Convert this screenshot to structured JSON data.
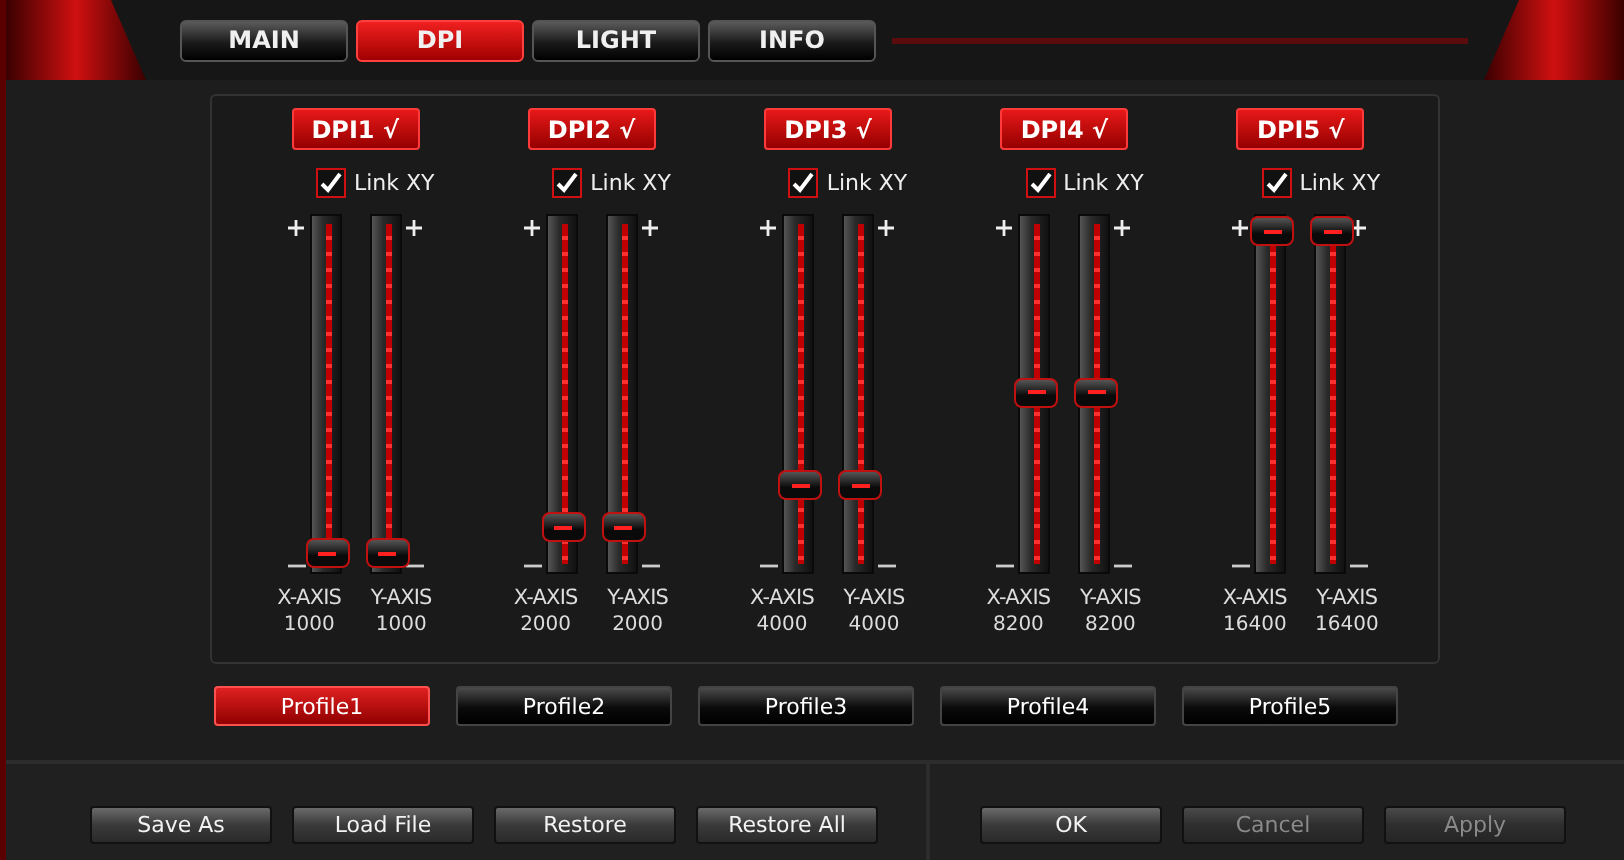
{
  "tabs": [
    {
      "label": "MAIN",
      "selected": false
    },
    {
      "label": "DPI",
      "selected": true
    },
    {
      "label": "LIGHT",
      "selected": false
    },
    {
      "label": "INFO",
      "selected": false
    }
  ],
  "dpi_stages": [
    {
      "label": "DPI1 √",
      "link_xy": {
        "label": "Link XY",
        "checked": true
      },
      "x_axis": {
        "label": "X-AXIS",
        "value": "1000",
        "level": 0
      },
      "y_axis": {
        "label": "Y-AXIS",
        "value": "1000",
        "level": 0
      }
    },
    {
      "label": "DPI2 √",
      "link_xy": {
        "label": "Link XY",
        "checked": true
      },
      "x_axis": {
        "label": "X-AXIS",
        "value": "2000",
        "level": 0.08
      },
      "y_axis": {
        "label": "Y-AXIS",
        "value": "2000",
        "level": 0.08
      }
    },
    {
      "label": "DPI3 √",
      "link_xy": {
        "label": "Link XY",
        "checked": true
      },
      "x_axis": {
        "label": "X-AXIS",
        "value": "4000",
        "level": 0.21
      },
      "y_axis": {
        "label": "Y-AXIS",
        "value": "4000",
        "level": 0.21
      }
    },
    {
      "label": "DPI4 √",
      "link_xy": {
        "label": "Link XY",
        "checked": true
      },
      "x_axis": {
        "label": "X-AXIS",
        "value": "8200",
        "level": 0.5
      },
      "y_axis": {
        "label": "Y-AXIS",
        "value": "8200",
        "level": 0.5
      }
    },
    {
      "label": "DPI5 √",
      "link_xy": {
        "label": "Link XY",
        "checked": true
      },
      "x_axis": {
        "label": "X-AXIS",
        "value": "16400",
        "level": 1
      },
      "y_axis": {
        "label": "Y-AXIS",
        "value": "16400",
        "level": 1
      }
    }
  ],
  "profiles": [
    {
      "label": "Profile1",
      "selected": true
    },
    {
      "label": "Profile2",
      "selected": false
    },
    {
      "label": "Profile3",
      "selected": false
    },
    {
      "label": "Profile4",
      "selected": false
    },
    {
      "label": "Profile5",
      "selected": false
    }
  ],
  "file_buttons": [
    {
      "label": "Save As",
      "disabled": false
    },
    {
      "label": "Load File",
      "disabled": false
    },
    {
      "label": "Restore",
      "disabled": false
    },
    {
      "label": "Restore All",
      "disabled": false
    }
  ],
  "dialog_buttons": [
    {
      "label": "OK",
      "disabled": false
    },
    {
      "label": "Cancel",
      "disabled": true
    },
    {
      "label": "Apply",
      "disabled": true
    }
  ]
}
